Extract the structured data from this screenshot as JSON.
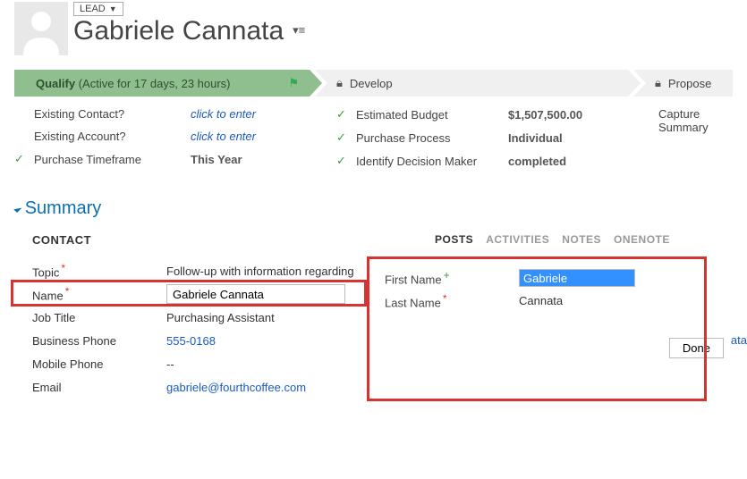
{
  "header": {
    "entity_label": "LEAD",
    "record_name": "Gabriele Cannata"
  },
  "stages": {
    "qualify": {
      "label": "Qualify",
      "duration": "(Active for 17 days, 23 hours)"
    },
    "develop": {
      "label": "Develop"
    },
    "propose": {
      "label": "Propose"
    }
  },
  "qualify_fields": {
    "existing_contact": {
      "label": "Existing Contact?",
      "value": "click to enter"
    },
    "existing_account": {
      "label": "Existing Account?",
      "value": "click to enter"
    },
    "purchase_timeframe": {
      "label": "Purchase Timeframe",
      "value": "This Year"
    }
  },
  "develop_fields": {
    "estimated_budget": {
      "label": "Estimated Budget",
      "value": "$1,507,500.00"
    },
    "purchase_process": {
      "label": "Purchase Process",
      "value": "Individual"
    },
    "decision_maker": {
      "label": "Identify Decision Maker",
      "value": "completed"
    }
  },
  "propose_fields": {
    "capture_summary": {
      "label": "Capture Summary"
    }
  },
  "summary": {
    "title": "Summary",
    "contact_heading": "CONTACT",
    "topic": {
      "label": "Topic",
      "value": "Follow-up with information regarding "
    },
    "name": {
      "label": "Name",
      "value": "Gabriele Cannata"
    },
    "job_title": {
      "label": "Job Title",
      "value": "Purchasing Assistant"
    },
    "business_phone": {
      "label": "Business Phone",
      "value": "555-0168"
    },
    "mobile_phone": {
      "label": "Mobile Phone",
      "value": "--"
    },
    "email": {
      "label": "Email",
      "value": "gabriele@fourthcoffee.com"
    }
  },
  "tabs": {
    "posts": "POSTS",
    "activities": "ACTIVITIES",
    "notes": "NOTES",
    "onenote": "ONENOTE"
  },
  "edit_panel": {
    "first_name": {
      "label": "First Name",
      "value": "Gabriele"
    },
    "last_name": {
      "label": "Last Name",
      "value": "Cannata"
    },
    "done": "Done"
  },
  "fragments": {
    "ata": "ata"
  }
}
